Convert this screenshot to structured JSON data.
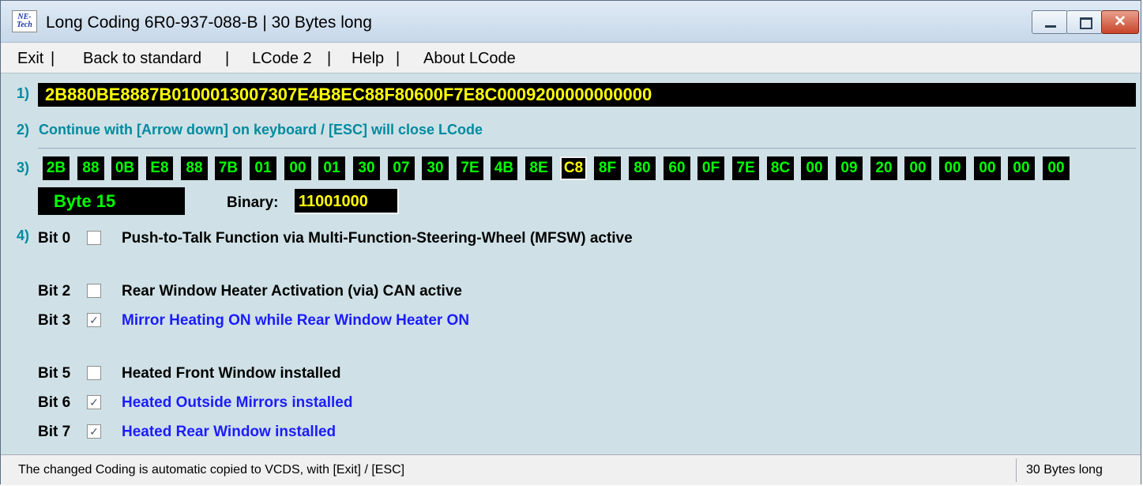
{
  "window": {
    "title": "Long Coding  6R0-937-088-B | 30 Bytes long",
    "icon_text": "NE-Tech",
    "close_glyph": "✕"
  },
  "menu": {
    "items": [
      "Exit",
      "Back to standard",
      "LCode 2",
      "Help",
      "About LCode"
    ],
    "separator": "|"
  },
  "steps": [
    "1)",
    "2)",
    "3)",
    "4)"
  ],
  "coding_string": "2B880BE8887B0100013007307E4B8EC88F80600F7E8C0009200000000000",
  "instruction": "Continue with [Arrow down] on keyboard / [ESC] will close LCode",
  "bytes": [
    "2B",
    "88",
    "0B",
    "E8",
    "88",
    "7B",
    "01",
    "00",
    "01",
    "30",
    "07",
    "30",
    "7E",
    "4B",
    "8E",
    "C8",
    "8F",
    "80",
    "60",
    "0F",
    "7E",
    "8C",
    "00",
    "09",
    "20",
    "00",
    "00",
    "00",
    "00",
    "00"
  ],
  "selected_byte_index": 15,
  "byte_label": "Byte 15",
  "binary_label": "Binary:",
  "binary_value": "11001000",
  "bits": [
    {
      "label": "Bit 0",
      "checked": false,
      "description": "Push-to-Talk Function via Multi-Function-Steering-Wheel (MFSW) active"
    },
    {
      "label": "Bit 2",
      "checked": false,
      "description": "Rear Window Heater Activation (via) CAN active"
    },
    {
      "label": "Bit 3",
      "checked": true,
      "description": "Mirror Heating ON while Rear Window Heater ON"
    },
    {
      "label": "Bit 5",
      "checked": false,
      "description": "Heated Front Window installed"
    },
    {
      "label": "Bit 6",
      "checked": true,
      "description": "Heated Outside Mirrors installed"
    },
    {
      "label": "Bit 7",
      "checked": true,
      "description": "Heated Rear Window installed"
    }
  ],
  "status": {
    "left": "The changed Coding is automatic copied to VCDS, with [Exit] / [ESC]",
    "right": "30 Bytes long"
  },
  "colors": {
    "window_bg": "#cfe1e6",
    "byte_text": "#00ff00",
    "highlight_text": "#ffff00",
    "checked_desc": "#1c1cff",
    "step_color": "#008aa0"
  }
}
